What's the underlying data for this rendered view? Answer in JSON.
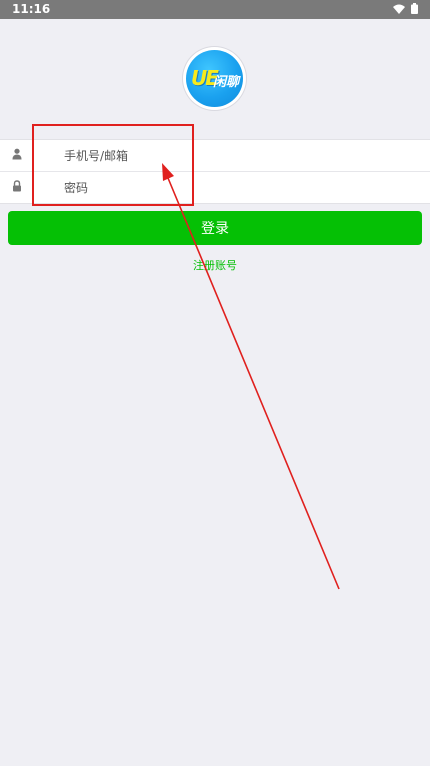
{
  "status_bar": {
    "time": "11:16",
    "wifi_icon": "wifi-icon",
    "battery_icon": "battery-icon"
  },
  "logo": {
    "mark": "UE",
    "text": "闲聊",
    "accent": "#1aa1ef"
  },
  "form": {
    "account_placeholder": "手机号/邮箱",
    "password_placeholder": "密码",
    "account_icon": "user-icon",
    "password_icon": "lock-icon"
  },
  "login_label": "登录",
  "register_label": "注册账号",
  "colors": {
    "primary": "#05c005",
    "annotation": "#e0201e",
    "background": "#efeff4"
  }
}
